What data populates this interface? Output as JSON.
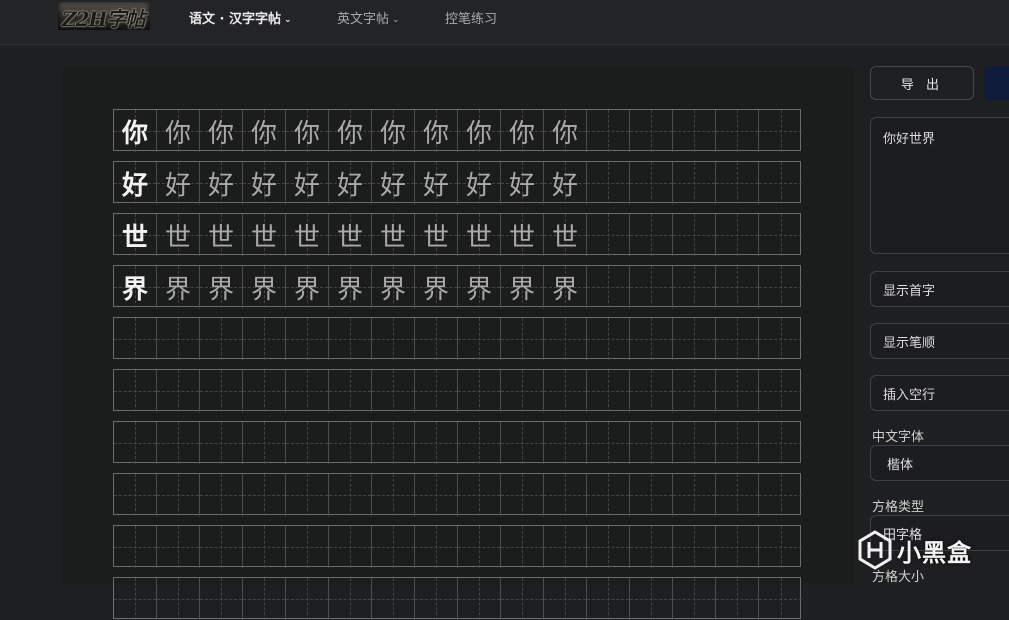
{
  "header": {
    "logo_text": "Z2H字帖",
    "nav": [
      {
        "label": "语文 · 汉字字帖",
        "active": true,
        "has_dropdown": true
      },
      {
        "label": "英文字帖",
        "active": false,
        "has_dropdown": true
      },
      {
        "label": "控笔练习",
        "active": false,
        "has_dropdown": false
      }
    ]
  },
  "sheet": {
    "characters": [
      "你",
      "好",
      "世",
      "界"
    ],
    "repeats_per_row": 11,
    "cells_per_row": 16,
    "total_rows": 10
  },
  "panel": {
    "export_label": "导 出",
    "input_text": "你好世界",
    "show_first_label": "显示首字",
    "show_stroke_order_label": "显示笔顺",
    "insert_blank_label": "插入空行",
    "cn_font_label": "中文字体",
    "cn_font_value": "楷体",
    "grid_type_label": "方格类型",
    "grid_type_value": "田字格",
    "grid_size_label": "方格大小"
  },
  "watermark": {
    "text": "小黑盒"
  },
  "colors": {
    "background": "#1e1f21",
    "sheet": "#1b1c1c",
    "primary_button": "#0f1b3a"
  }
}
